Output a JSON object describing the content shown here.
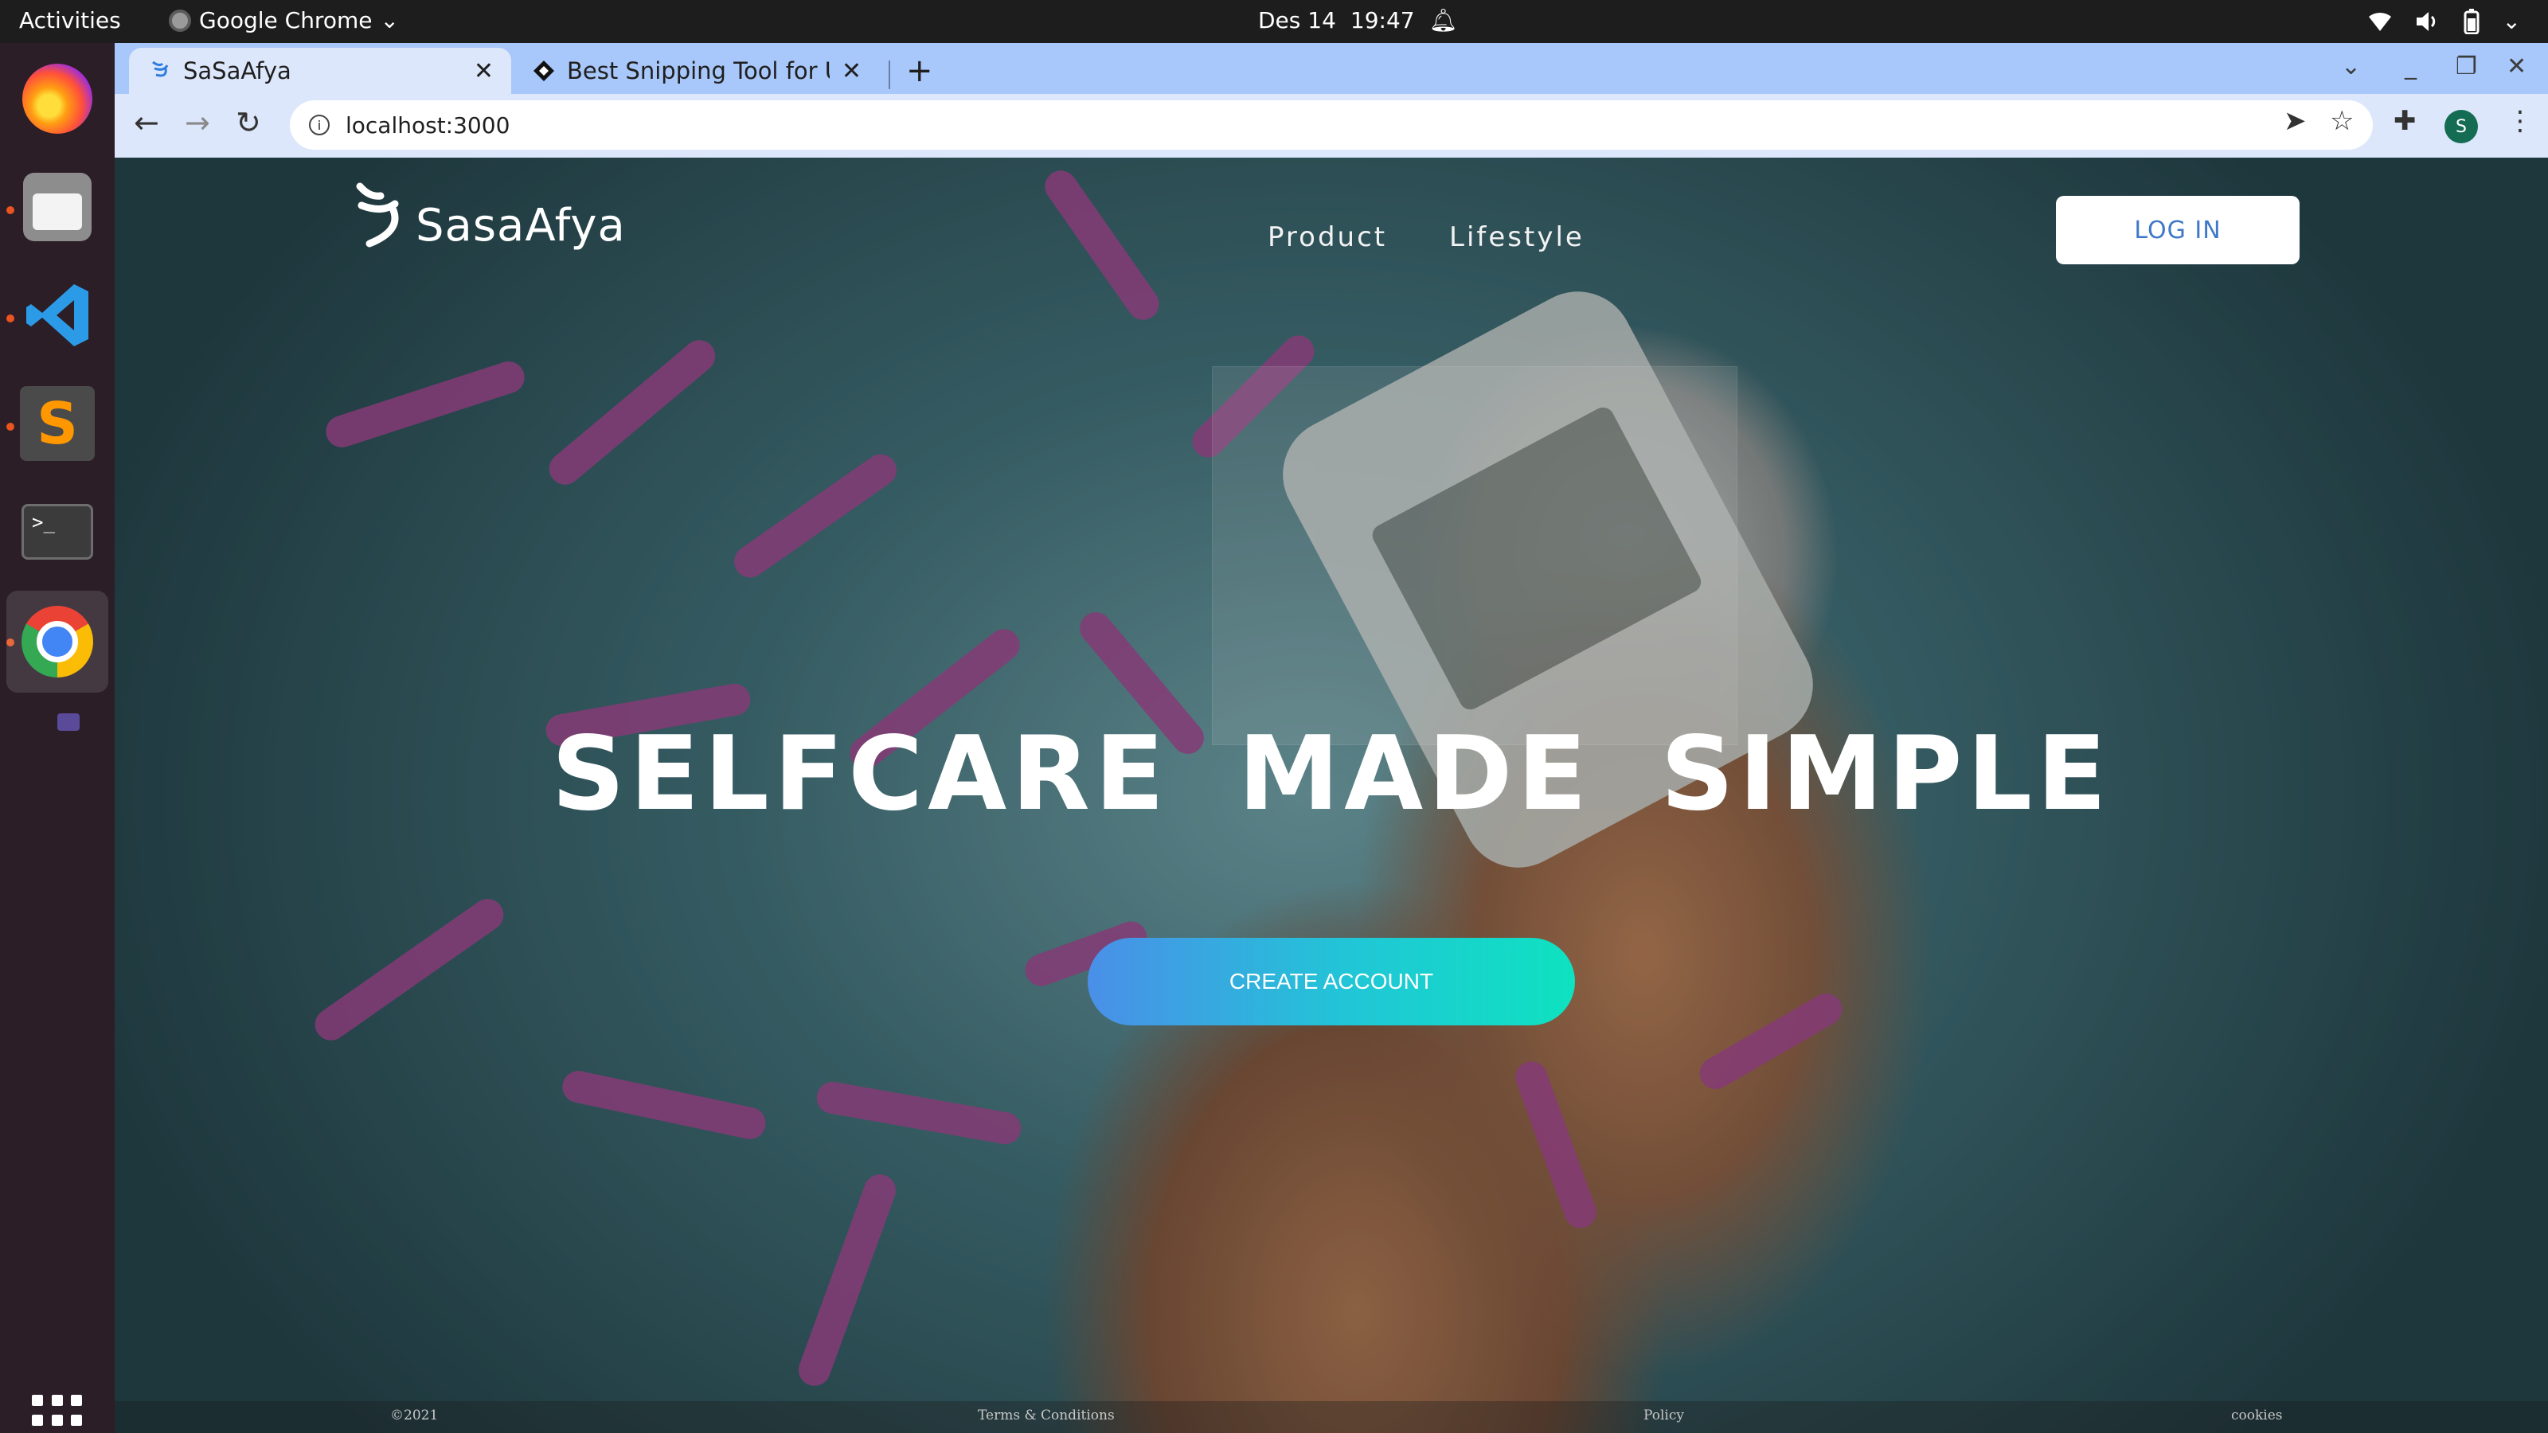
{
  "system": {
    "activities_label": "Activities",
    "app_name": "Google Chrome",
    "date": "Des 14",
    "time": "19:47"
  },
  "dock": {
    "apps": [
      "firefox-icon",
      "files-icon",
      "vscode-icon",
      "sublime-text-icon",
      "terminal-icon",
      "chrome-icon"
    ],
    "show_apps_label": "Show Applications"
  },
  "browser": {
    "tabs": [
      {
        "label": "SaSaAfya",
        "active": true
      },
      {
        "label": "Best Snipping Tool for Ub",
        "active": false
      }
    ],
    "url": "localhost:3000",
    "profile_initial": "S"
  },
  "site": {
    "logo_text": "SasaAfya",
    "nav": {
      "product": "Product",
      "lifestyle": "Lifestyle"
    },
    "login_label": "LOG IN",
    "hero_title": "SELFCARE MADE SIMPLE",
    "cta_label": "CREATE ACCOUNT",
    "footer": {
      "copyright": "©2021",
      "terms": "Terms & Conditions",
      "policy": "Policy",
      "cookies": "cookies"
    },
    "colors": {
      "cta_start": "#4a8fe8",
      "cta_end": "#0ee2c0",
      "login_text": "#3e78c8"
    }
  }
}
